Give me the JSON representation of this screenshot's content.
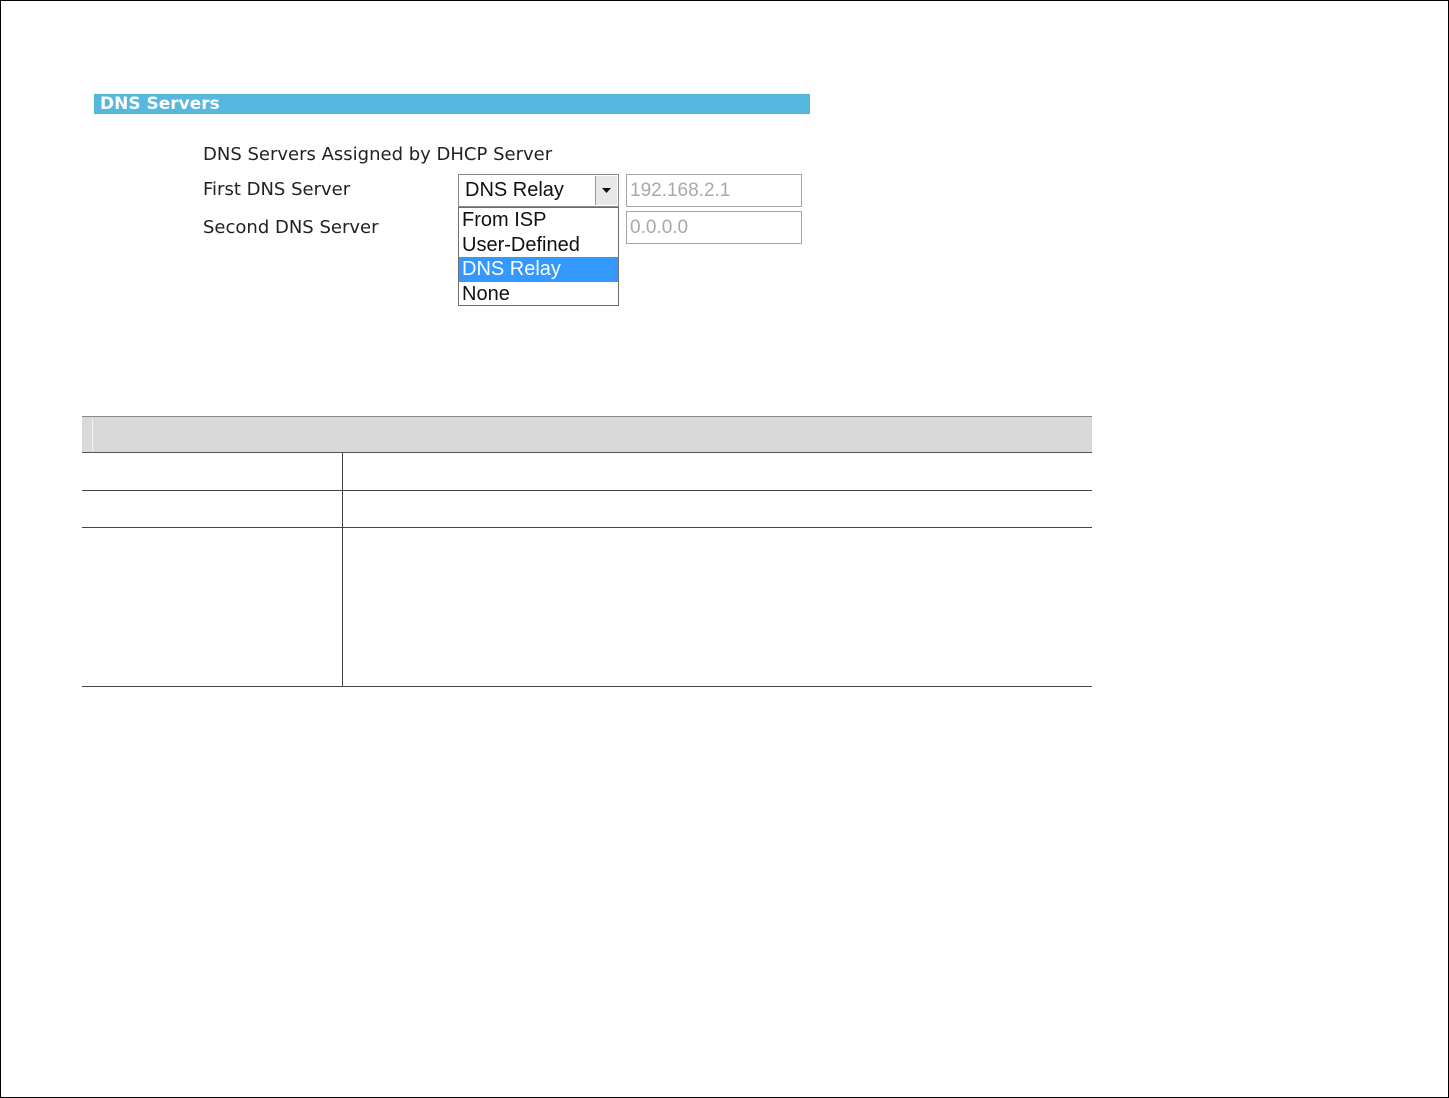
{
  "section": {
    "title": "DNS Servers"
  },
  "form": {
    "assigned_label": "DNS Servers Assigned by DHCP Server",
    "first_dns_label": "First DNS Server",
    "second_dns_label": "Second DNS Server",
    "first_dns_mode": "DNS Relay",
    "first_dns_ip": "192.168.2.1",
    "second_dns_ip": "0.0.0.0"
  },
  "dropdown": {
    "options": [
      "From ISP",
      "User-Defined",
      "DNS Relay",
      "None"
    ],
    "selected": "DNS Relay"
  },
  "icons": {
    "select_arrow": "chevron-down-icon"
  },
  "colors": {
    "header_bg": "#56b8de",
    "highlight": "#3399ff",
    "table_header_bg": "#d9d9d9"
  }
}
